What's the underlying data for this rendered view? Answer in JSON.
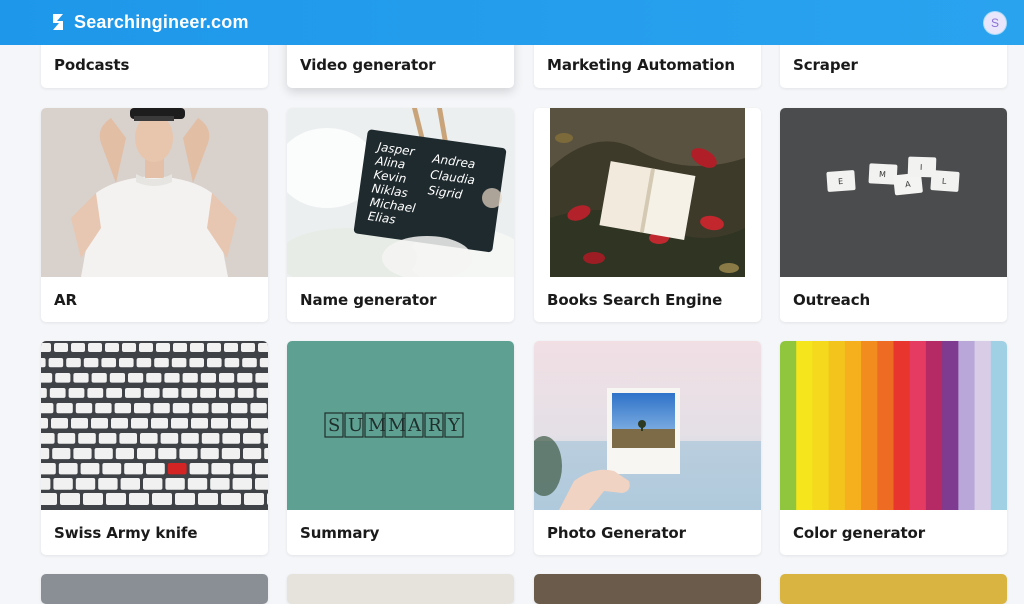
{
  "header": {
    "brand_name": "Searchingineer.com",
    "logo_icon": "s-logo-icon",
    "avatar_initial": "S"
  },
  "colors": {
    "header_blue": "#1e97ea",
    "page_bg": "#f4f6f9",
    "avatar_bg": "#e9e6fb"
  },
  "cards": [
    {
      "label": "Podcasts"
    },
    {
      "label": "Video generator"
    },
    {
      "label": "Marketing Automation"
    },
    {
      "label": "Scraper"
    },
    {
      "label": "AR"
    },
    {
      "label": "Name generator"
    },
    {
      "label": "Books Search Engine"
    },
    {
      "label": "Outreach"
    },
    {
      "label": "Swiss Army knife"
    },
    {
      "label": "Summary"
    },
    {
      "label": "Photo Generator"
    },
    {
      "label": "Color generator"
    }
  ],
  "images": {
    "outreach_tiles": [
      "E",
      "M",
      "A",
      "I",
      "L"
    ],
    "summary_text": "SUMMARY",
    "name_list_left": [
      "Jasper",
      "Alina",
      "Kevin",
      "Niklas",
      "Michael",
      "Elias"
    ],
    "name_list_right": [
      "Andrea",
      "Claudia",
      "Sigrid"
    ]
  }
}
